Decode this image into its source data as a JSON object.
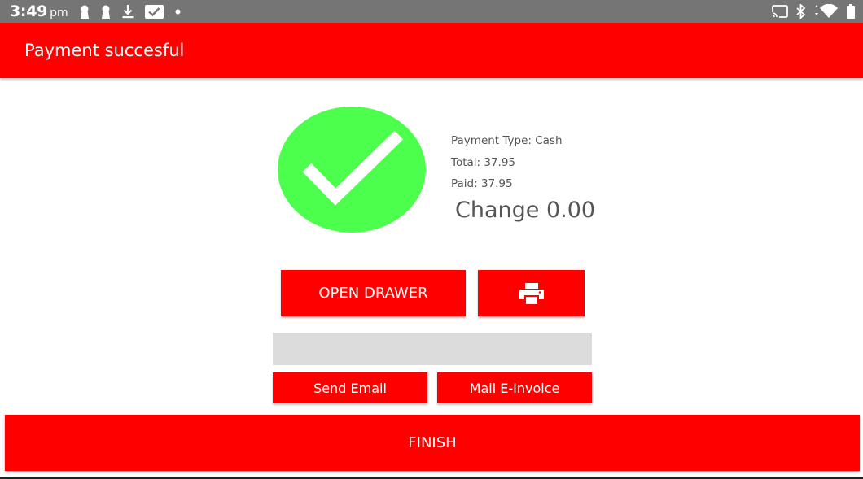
{
  "status_bar": {
    "time": "3:49",
    "ampm": "pm",
    "left_icons": [
      "keyhole-icon",
      "keyhole-icon",
      "download-icon",
      "mail-icon",
      "dot-icon"
    ],
    "right_icons": [
      "cast-icon",
      "bluetooth-icon",
      "wifi-icon",
      "battery-icon"
    ]
  },
  "app_bar": {
    "title": "Payment succesful"
  },
  "payment": {
    "type": "Payment Type: Cash",
    "total": "Total: 37.95",
    "paid": "Paid: 37.95",
    "change": "Change 0.00"
  },
  "actions": {
    "open_drawer": "OPEN DRAWER",
    "print_icon": "printer-icon",
    "email_value": "",
    "send_email": "Send Email",
    "mail_invoice": "Mail E-Invoice",
    "finish": "FINISH"
  },
  "colors": {
    "accent": "#ff0000",
    "success": "#4cff4c",
    "status_bar": "#757575",
    "input_bg": "#dcdcdc"
  }
}
